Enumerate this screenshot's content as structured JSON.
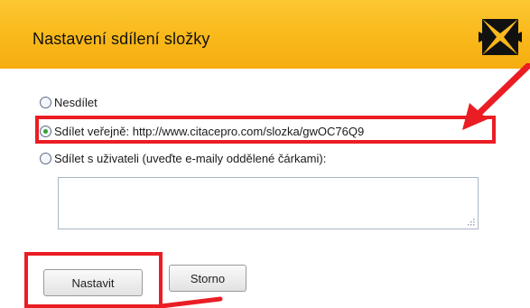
{
  "dialog": {
    "title": "Nastavení sdílení složky",
    "close_icon": "close-x-icon"
  },
  "options": [
    {
      "label": "Nesdílet",
      "selected": false
    },
    {
      "label": "Sdílet veřejně: http://www.citacepro.com/slozka/gwOC76Q9",
      "selected": true
    },
    {
      "label": "Sdílet s uživateli (uveďte e-maily oddělené čárkami):",
      "selected": false
    }
  ],
  "emails_field": {
    "value": ""
  },
  "buttons": {
    "set_label": "Nastavit",
    "cancel_label": "Storno"
  },
  "colors": {
    "header": "#f9b81a",
    "highlight": "#ea1d24"
  }
}
